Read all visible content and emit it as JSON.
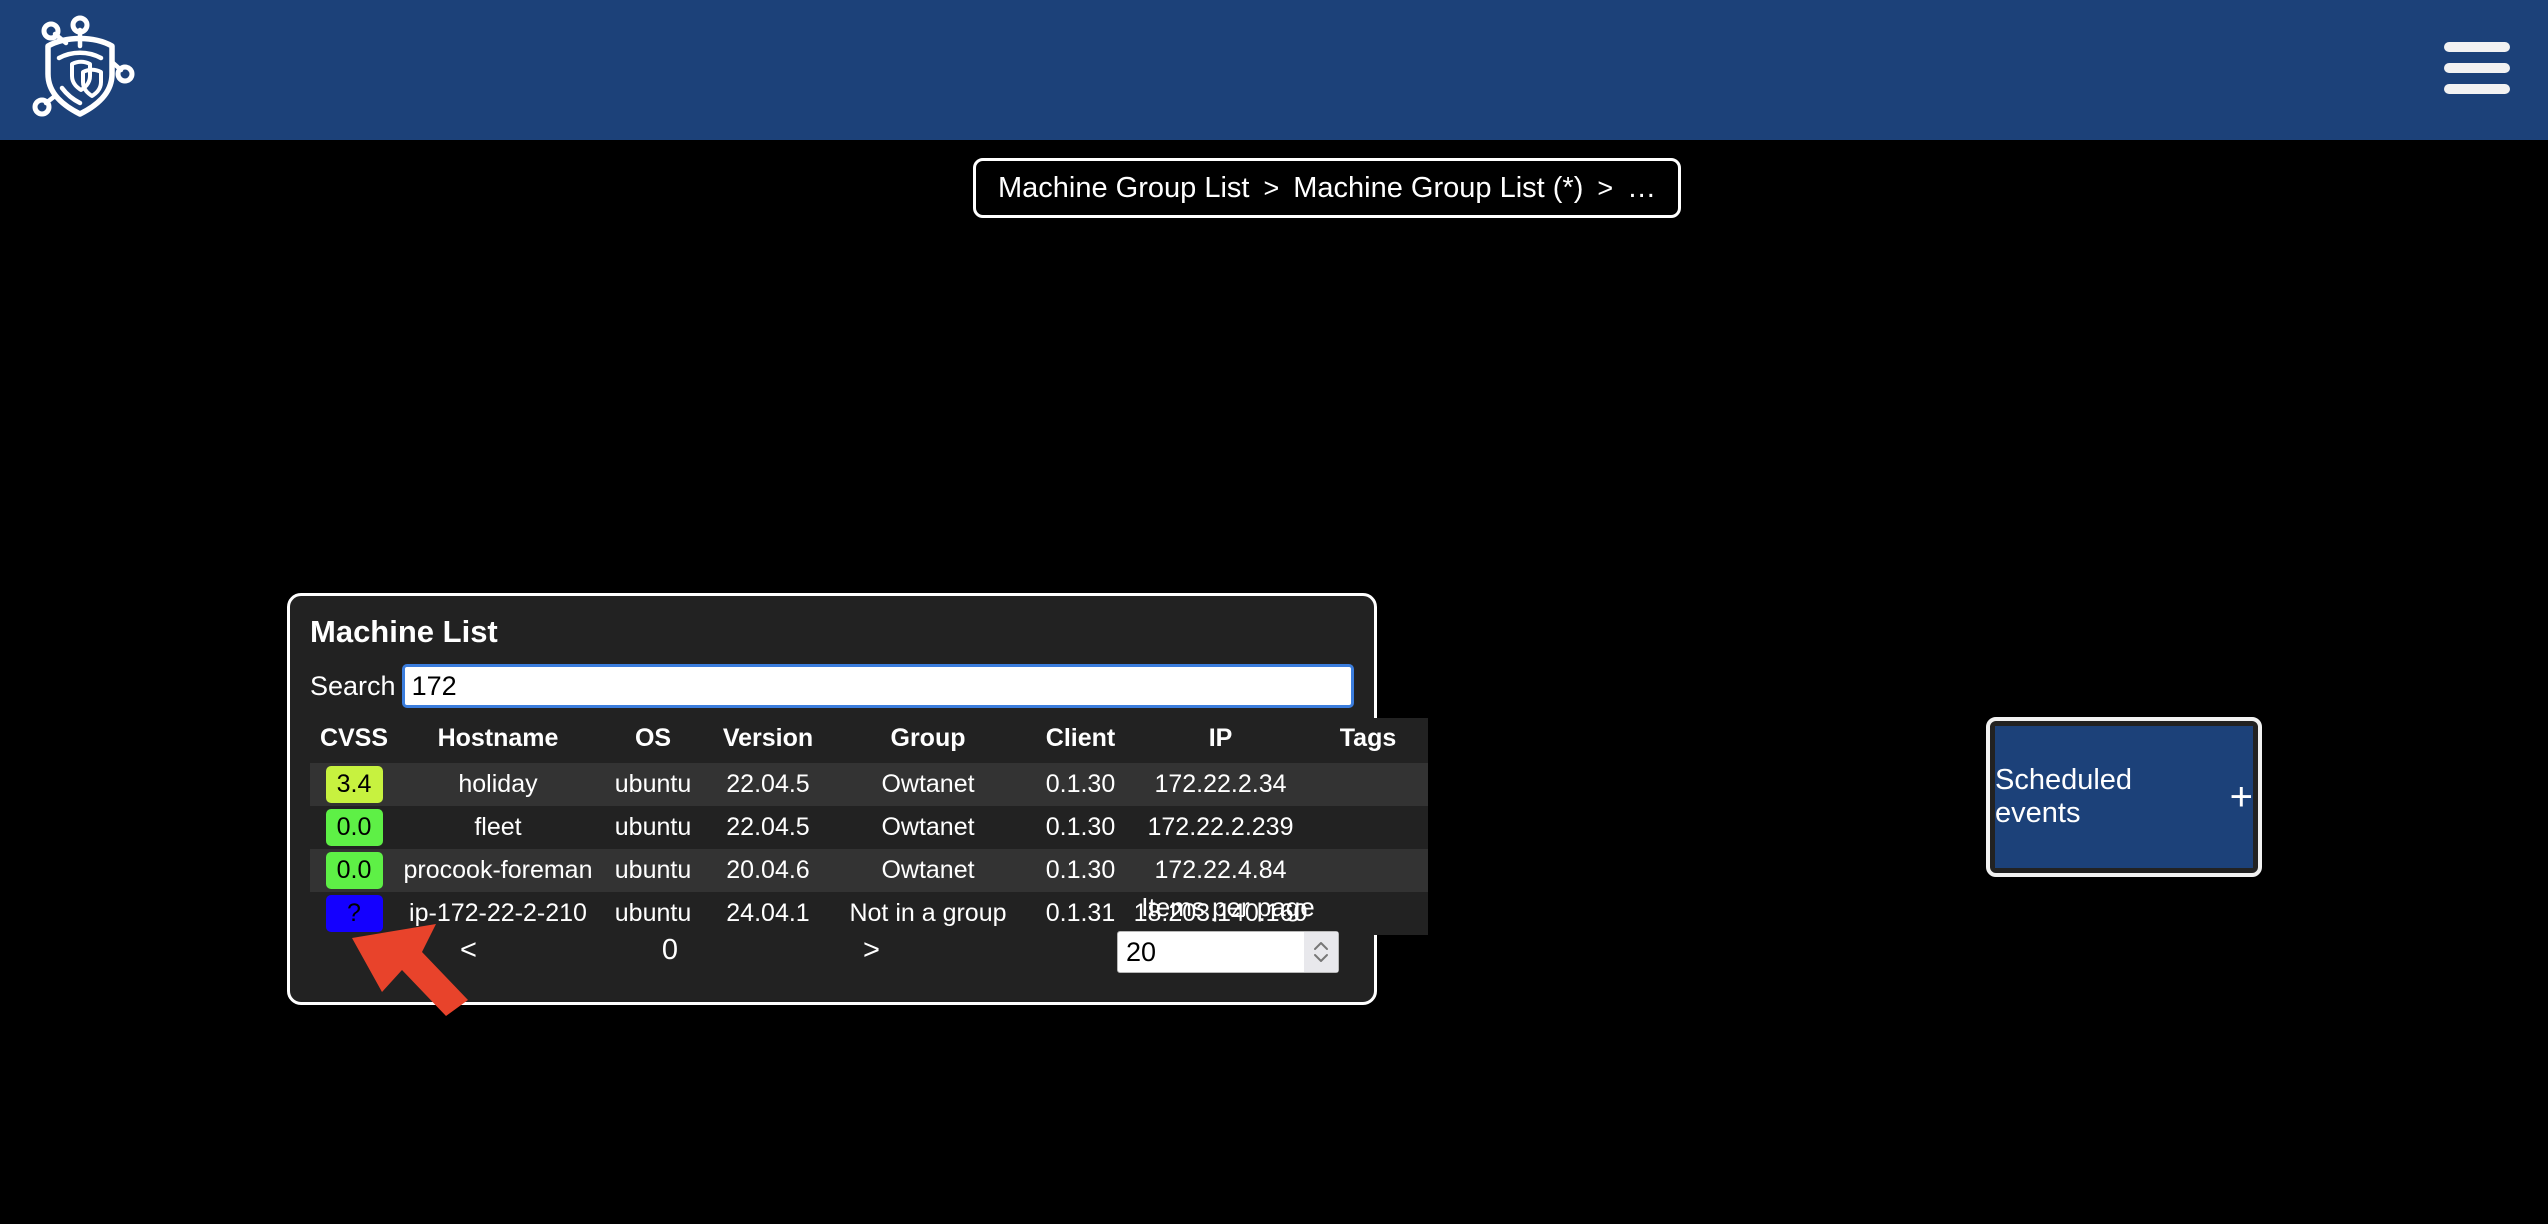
{
  "header": {
    "logo_name": "shield-circuit-logo",
    "menu_label": "menu-icon",
    "background_color": "#1c4179"
  },
  "breadcrumb": {
    "items": [
      "Machine Group List",
      "Machine Group List (*)",
      "…"
    ],
    "separator": ">"
  },
  "panel": {
    "title": "Machine List",
    "search": {
      "label": "Search",
      "value": "172",
      "placeholder": ""
    },
    "table": {
      "columns": [
        "CVSS",
        "Hostname",
        "OS",
        "Version",
        "Group",
        "Client",
        "IP",
        "Tags"
      ],
      "rows": [
        {
          "cvss": "3.4",
          "cvss_color": "#c7f23f",
          "hostname": "holiday",
          "os": "ubuntu",
          "version": "22.04.5",
          "group": "Owtanet",
          "client": "0.1.30",
          "ip": "172.22.2.34",
          "tags": ""
        },
        {
          "cvss": "0.0",
          "cvss_color": "#5ef046",
          "hostname": "fleet",
          "os": "ubuntu",
          "version": "22.04.5",
          "group": "Owtanet",
          "client": "0.1.30",
          "ip": "172.22.2.239",
          "tags": ""
        },
        {
          "cvss": "0.0",
          "cvss_color": "#5ef046",
          "hostname": "procook-foreman",
          "os": "ubuntu",
          "version": "20.04.6",
          "group": "Owtanet",
          "client": "0.1.30",
          "ip": "172.22.4.84",
          "tags": ""
        },
        {
          "cvss": "?",
          "cvss_color": "#1400ff",
          "hostname": "ip-172-22-2-210",
          "os": "ubuntu",
          "version": "24.04.1",
          "group": "Not in a group",
          "client": "0.1.31",
          "ip": "18.203.140.160",
          "tags": ""
        }
      ]
    },
    "pagination": {
      "prev_label": "<",
      "page_label": "0",
      "next_label": ">",
      "items_per_page_label": "Items per page",
      "items_per_page_value": "20"
    }
  },
  "annotation": {
    "arrow_name": "red-pointer-arrow",
    "arrow_color": "#e8432b"
  },
  "scheduled_events": {
    "label": "Scheduled events",
    "add_label": "+",
    "background_color": "#1c4179"
  }
}
